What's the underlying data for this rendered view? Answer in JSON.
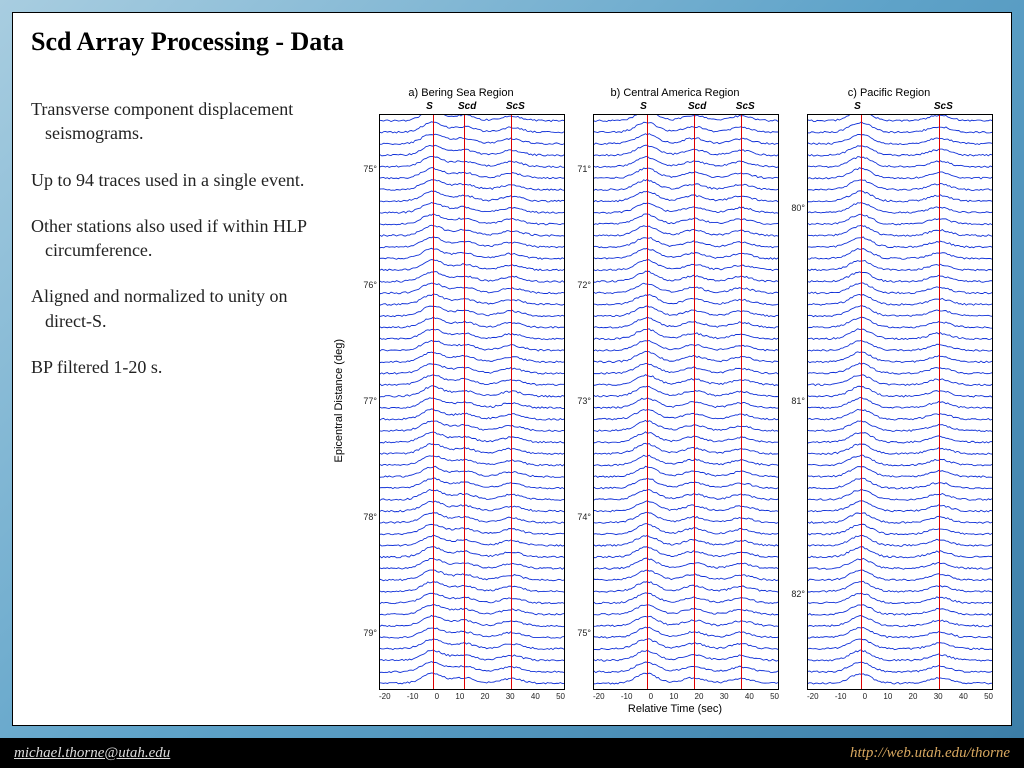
{
  "title": "Scd Array Processing - Data",
  "bullets": [
    "Transverse component displacement seismograms.",
    "Up to 94 traces used in a single event.",
    "Other stations also used if within HLP circumference.",
    "Aligned and normalized to unity on direct-S.",
    "BP filtered 1-20 s."
  ],
  "ylabel": "Epicentral Distance (deg)",
  "xlabel": "Relative Time (sec)",
  "footer": {
    "email": "michael.thorne@utah.edu",
    "url": "http://web.utah.edu/thorne"
  },
  "chart_data": [
    {
      "id": "a",
      "title": "a) Bering Sea Region",
      "type": "line",
      "phases": [
        "S",
        "Scd",
        "ScS"
      ],
      "phase_times_sec": [
        0,
        12,
        30
      ],
      "xlabel": "Relative Time (sec)",
      "ylabel": "Epicentral Distance (deg)",
      "xlim": [
        -20,
        50
      ],
      "xticks": [
        -20,
        -10,
        0,
        10,
        20,
        30,
        40,
        50
      ],
      "ylim": [
        79,
        75
      ],
      "yticks": [
        "75°",
        "76°",
        "77°",
        "78°",
        "79°"
      ],
      "n_traces": 94,
      "note": "Stacked transverse seismogram traces; each trace is a waveform aligned on S arrival and normalized to unity."
    },
    {
      "id": "b",
      "title": "b) Central America Region",
      "type": "line",
      "phases": [
        "S",
        "Scd",
        "ScS"
      ],
      "phase_times_sec": [
        0,
        18,
        36
      ],
      "xlabel": "Relative Time (sec)",
      "ylabel": "Epicentral Distance (deg)",
      "xlim": [
        -20,
        50
      ],
      "xticks": [
        -20,
        -10,
        0,
        10,
        20,
        30,
        40,
        50
      ],
      "ylim": [
        75,
        71
      ],
      "yticks": [
        "71°",
        "72°",
        "73°",
        "74°",
        "75°"
      ],
      "n_traces": 94,
      "note": "Stacked transverse seismogram traces; each trace is a waveform aligned on S arrival and normalized to unity."
    },
    {
      "id": "c",
      "title": "c) Pacific Region",
      "type": "line",
      "phases": [
        "S",
        "ScS"
      ],
      "phase_times_sec": [
        0,
        30
      ],
      "xlabel": "Relative Time (sec)",
      "ylabel": "Epicentral Distance (deg)",
      "xlim": [
        -20,
        50
      ],
      "xticks": [
        -20,
        -10,
        0,
        10,
        20,
        30,
        40,
        50
      ],
      "ylim": [
        82,
        80
      ],
      "yticks": [
        "80°",
        "81°",
        "82°"
      ],
      "n_traces": 94,
      "note": "Stacked transverse seismogram traces; each trace is a waveform aligned on S arrival and normalized to unity."
    }
  ]
}
